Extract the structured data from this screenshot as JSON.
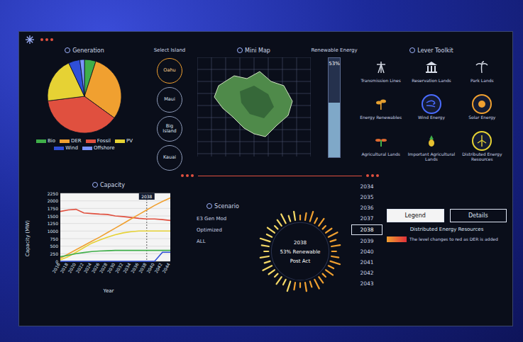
{
  "generation": {
    "title": "Generation",
    "slices": [
      {
        "name": "Bio",
        "value": 5,
        "color": "#3fae49"
      },
      {
        "name": "DER",
        "value": 30,
        "color": "#f0a030"
      },
      {
        "name": "Fossil",
        "value": 38,
        "color": "#e0503f"
      },
      {
        "name": "PV",
        "value": 20,
        "color": "#e6d234"
      },
      {
        "name": "Wind",
        "value": 5,
        "color": "#2f4fd8"
      },
      {
        "name": "Offshore",
        "value": 2,
        "color": "#7b93ff"
      }
    ]
  },
  "island_select": {
    "title": "Select Island",
    "islands": [
      {
        "label": "Oahu",
        "selected": true
      },
      {
        "label": "Maui",
        "selected": false
      },
      {
        "label": "Big Island",
        "selected": false
      },
      {
        "label": "Kauai",
        "selected": false
      }
    ]
  },
  "minimap": {
    "title": "Mini Map"
  },
  "renewable": {
    "title": "Renewable Energy",
    "level": 0.55,
    "reading": "53%"
  },
  "lever_toolkit": {
    "title": "Lever Toolkit",
    "items": [
      {
        "label": "Transmission Lines",
        "selected": false,
        "color": "#d8dde8"
      },
      {
        "label": "Reservation Lands",
        "selected": false,
        "color": "#d8dde8"
      },
      {
        "label": "Park Lands",
        "selected": false,
        "color": "#d8dde8"
      },
      {
        "label": "Energy Renewables",
        "selected": false,
        "color": "#e6a030"
      },
      {
        "label": "Wind Energy",
        "selected": true,
        "color": "#4a6cff"
      },
      {
        "label": "Solar Energy",
        "selected": true,
        "color": "#f0a030"
      },
      {
        "label": "Agricultural Lands",
        "selected": false,
        "color": "#e06a30"
      },
      {
        "label": "Important Agricultural Lands",
        "selected": false,
        "color": "#e6c030"
      },
      {
        "label": "Distributed Energy Resources",
        "selected": true,
        "color": "#e6d234"
      }
    ]
  },
  "capacity": {
    "title": "Capacity",
    "y_label": "Capacity (MW)",
    "x_label": "Year",
    "marker": "2038",
    "y_max": 2250,
    "y_ticks": [
      "2250",
      "2000",
      "1750",
      "1500",
      "1250",
      "1000",
      "750",
      "500",
      "250",
      "0"
    ],
    "x_ticks": [
      "2016",
      "2018",
      "2020",
      "2022",
      "2024",
      "2026",
      "2028",
      "2030",
      "2032",
      "2034",
      "2036",
      "2038",
      "2040",
      "2042",
      "2044"
    ],
    "series": [
      {
        "name": "Fossil",
        "color": "#e0503f",
        "values": [
          1650,
          1700,
          1720,
          1600,
          1580,
          1560,
          1550,
          1500,
          1480,
          1450,
          1420,
          1400,
          1400,
          1380,
          1350
        ]
      },
      {
        "name": "DER",
        "color": "#f0a030",
        "values": [
          100,
          240,
          380,
          520,
          660,
          800,
          950,
          1100,
          1250,
          1400,
          1550,
          1700,
          1850,
          1980,
          2100
        ]
      },
      {
        "name": "PV",
        "color": "#e6d234",
        "values": [
          50,
          150,
          300,
          450,
          600,
          700,
          800,
          880,
          940,
          980,
          1000,
          1000,
          1000,
          1000,
          1000
        ]
      },
      {
        "name": "Bio",
        "color": "#3fae49",
        "values": [
          150,
          200,
          250,
          290,
          320,
          340,
          350,
          360,
          360,
          360,
          360,
          360,
          360,
          360,
          360
        ]
      },
      {
        "name": "Wind",
        "color": "#2f4fd8",
        "values": [
          0,
          0,
          0,
          0,
          0,
          0,
          0,
          0,
          0,
          0,
          0,
          0,
          0,
          300,
          300
        ]
      }
    ]
  },
  "scenario": {
    "title": "Scenario",
    "items": [
      "E3 Gen Mod",
      "Optimized",
      "ALL"
    ]
  },
  "dial": {
    "year": "2038",
    "share": "53% Renewable",
    "plan": "Post Act",
    "level": 0.53
  },
  "years": [
    {
      "label": "2034",
      "selected": false
    },
    {
      "label": "2035",
      "selected": false
    },
    {
      "label": "2036",
      "selected": false
    },
    {
      "label": "2037",
      "selected": false
    },
    {
      "label": "2038",
      "selected": true
    },
    {
      "label": "2039",
      "selected": false
    },
    {
      "label": "2040",
      "selected": false
    },
    {
      "label": "2041",
      "selected": false
    },
    {
      "label": "2042",
      "selected": false
    },
    {
      "label": "2043",
      "selected": false
    }
  ],
  "buttons": [
    {
      "label": "Legend",
      "selected": true
    },
    {
      "label": "Details",
      "selected": false
    }
  ],
  "der": {
    "title": "Distributed Energy Resources",
    "note": "The level changes to red as DER is added"
  }
}
